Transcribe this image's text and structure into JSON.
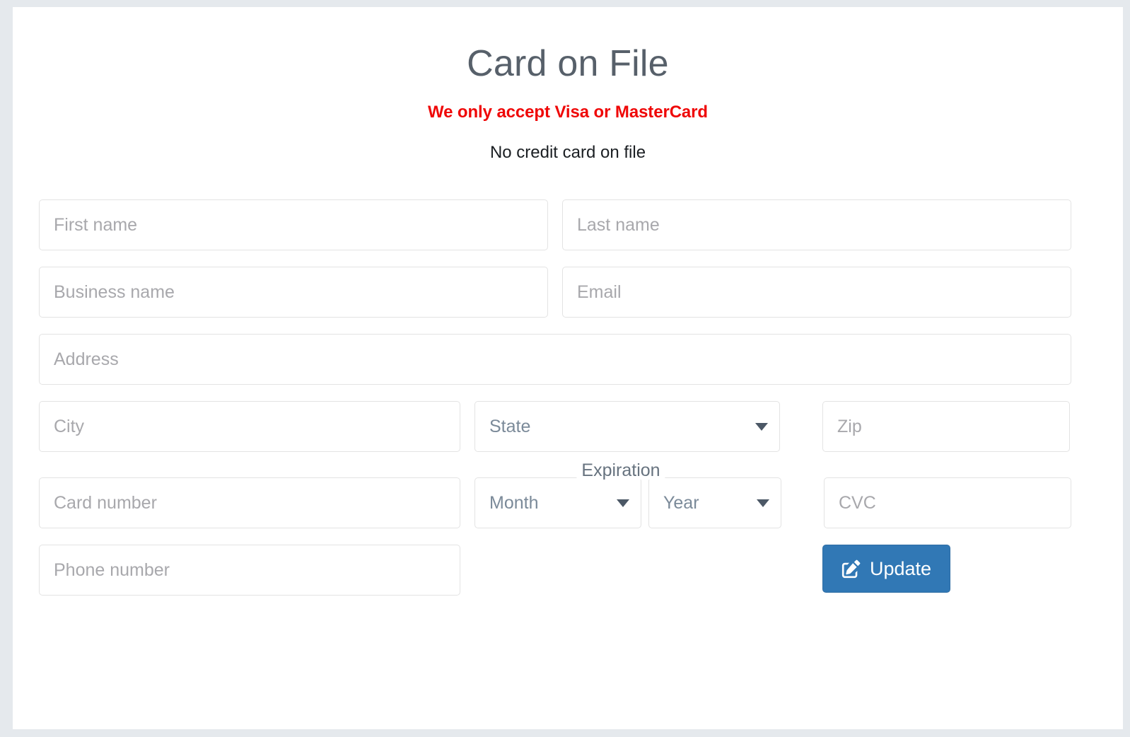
{
  "header": {
    "title": "Card on File",
    "notice": "We only accept Visa or MasterCard",
    "status": "No credit card on file"
  },
  "colors": {
    "page_background": "#e5e9ed",
    "card_background": "#ffffff",
    "title": "#57606a",
    "notice_red": "#ef0707",
    "status_text": "#1b1f23",
    "input_border": "#e3e3e3",
    "placeholder": "#a8a8ac",
    "select_text": "#7b8a99",
    "button_blue": "#3178b5",
    "button_border": "#2e6da4",
    "button_text": "#ffffff"
  },
  "form": {
    "first_name": {
      "placeholder": "First name",
      "value": ""
    },
    "last_name": {
      "placeholder": "Last name",
      "value": ""
    },
    "business_name": {
      "placeholder": "Business name",
      "value": ""
    },
    "email": {
      "placeholder": "Email",
      "value": ""
    },
    "address": {
      "placeholder": "Address",
      "value": ""
    },
    "city": {
      "placeholder": "City",
      "value": ""
    },
    "state": {
      "placeholder": "State",
      "selected": "State"
    },
    "zip": {
      "placeholder": "Zip",
      "value": ""
    },
    "card_number": {
      "placeholder": "Card number",
      "value": ""
    },
    "expiration_label": "Expiration",
    "expiration_month": {
      "placeholder": "Month",
      "selected": "Month"
    },
    "expiration_year": {
      "placeholder": "Year",
      "selected": "Year"
    },
    "cvc": {
      "placeholder": "CVC",
      "value": ""
    },
    "phone_number": {
      "placeholder": "Phone number",
      "value": ""
    }
  },
  "actions": {
    "update_label": "Update",
    "update_icon": "pen-to-square-icon"
  }
}
